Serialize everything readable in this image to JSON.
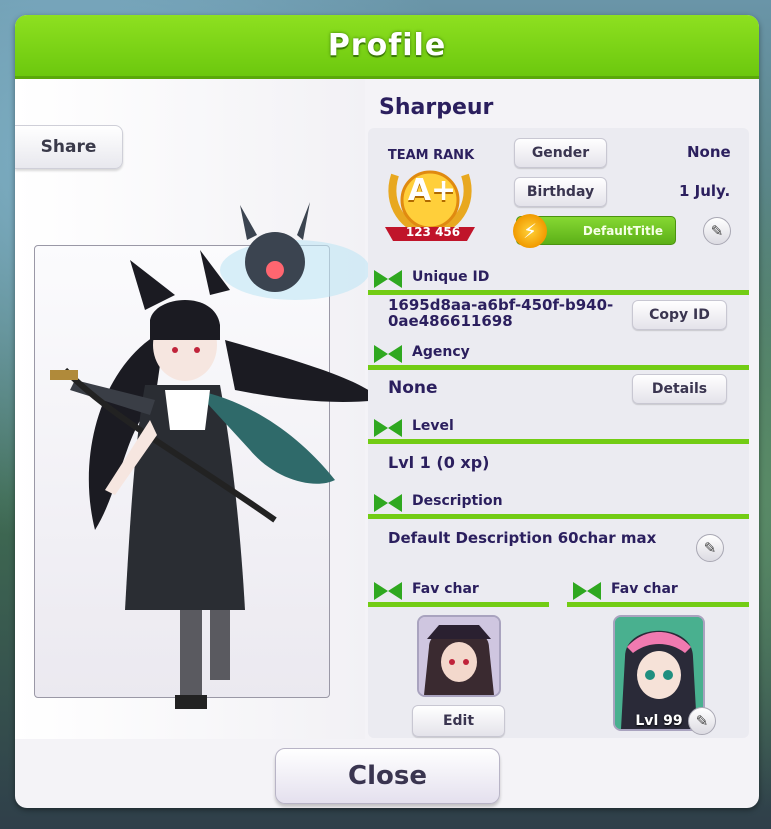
{
  "header": {
    "title": "Profile"
  },
  "share_label": "Share",
  "profile": {
    "name": "Sharpeur",
    "team_rank": {
      "label": "TEAM RANK",
      "grade": "A+",
      "points": "123 456"
    },
    "gender_label": "Gender",
    "gender_value": "None",
    "birthday_label": "Birthday",
    "birthday_value": "1 July.",
    "title_chip": "DefaultTitle"
  },
  "sections": {
    "unique_id": {
      "label": "Unique ID",
      "value": "1695d8aa-a6bf-450f-b940-0ae486611698",
      "button": "Copy ID"
    },
    "agency": {
      "label": "Agency",
      "value": "None",
      "button": "Details"
    },
    "level": {
      "label": "Level",
      "value": "Lvl 1 (0 xp)"
    },
    "description": {
      "label": "Description",
      "value": "Default Description 60char max"
    },
    "fav_char_1": {
      "label": "Fav char",
      "button": "Edit"
    },
    "fav_char_2": {
      "label": "Fav char",
      "level": "Lvl 99"
    }
  },
  "close_label": "Close",
  "colors": {
    "accent_green": "#72cc14",
    "text_dark": "#2b1f5e"
  },
  "icons": [
    "lightning-icon",
    "pencil-icon",
    "bow-icon"
  ]
}
